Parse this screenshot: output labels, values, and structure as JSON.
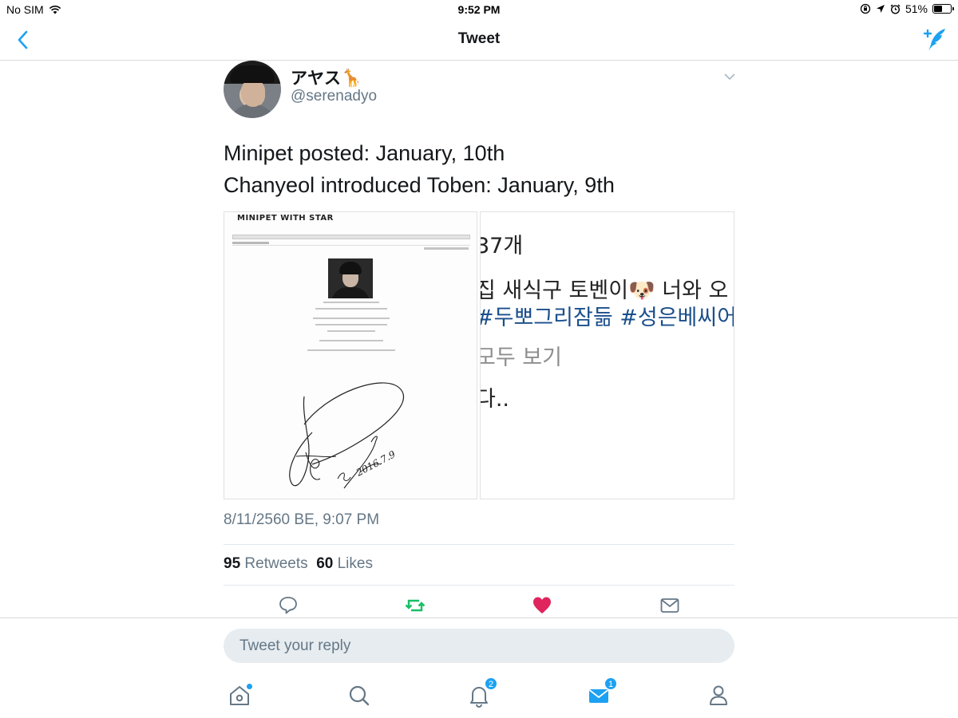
{
  "status_bar": {
    "carrier": "No SIM",
    "time": "9:52 PM",
    "battery": "51%",
    "battery_level": 0.51,
    "icons": [
      "wifi-icon",
      "lock-rotation-icon",
      "location-arrow-icon",
      "alarm-icon",
      "battery-icon"
    ]
  },
  "nav": {
    "title": "Tweet",
    "back_icon": "chevron-left-icon",
    "compose_icon": "compose-tweet-icon"
  },
  "tweet": {
    "display_name": "アヤス🦒",
    "handle": "@serenadyo",
    "text_lines": [
      "Minipet posted: January, 10th",
      "Chanyeol introduced Toben: January, 9th"
    ],
    "media_left": {
      "title": "MINIPET WITH STAR",
      "signature_date": "2016.7.9"
    },
    "media_right": {
      "line1": "37개",
      "line2": "집 새식구 토벤이🐶 너와 오",
      "line3": "#두뽀그리잠듦 #성은베씨어",
      "line4": "모두 보기",
      "line5": "다.."
    },
    "timestamp": "8/11/2560 BE, 9:07 PM",
    "retweets_count": "95",
    "retweets_label": "Retweets",
    "likes_count": "60",
    "likes_label": "Likes",
    "actions": [
      "reply-icon",
      "retweet-icon",
      "like-icon",
      "direct-message-icon"
    ],
    "colors": {
      "retweet": "#17bf63",
      "like": "#e0245e",
      "accent": "#1da1f2"
    }
  },
  "reply": {
    "placeholder": "Tweet your reply"
  },
  "tabbar": {
    "tabs": [
      {
        "name": "home",
        "icon": "home-icon",
        "dot": true
      },
      {
        "name": "search",
        "icon": "search-icon"
      },
      {
        "name": "notifications",
        "icon": "bell-icon",
        "badge": "2"
      },
      {
        "name": "messages",
        "icon": "envelope-icon",
        "badge": "1",
        "active": true
      },
      {
        "name": "profile",
        "icon": "person-icon"
      }
    ]
  }
}
